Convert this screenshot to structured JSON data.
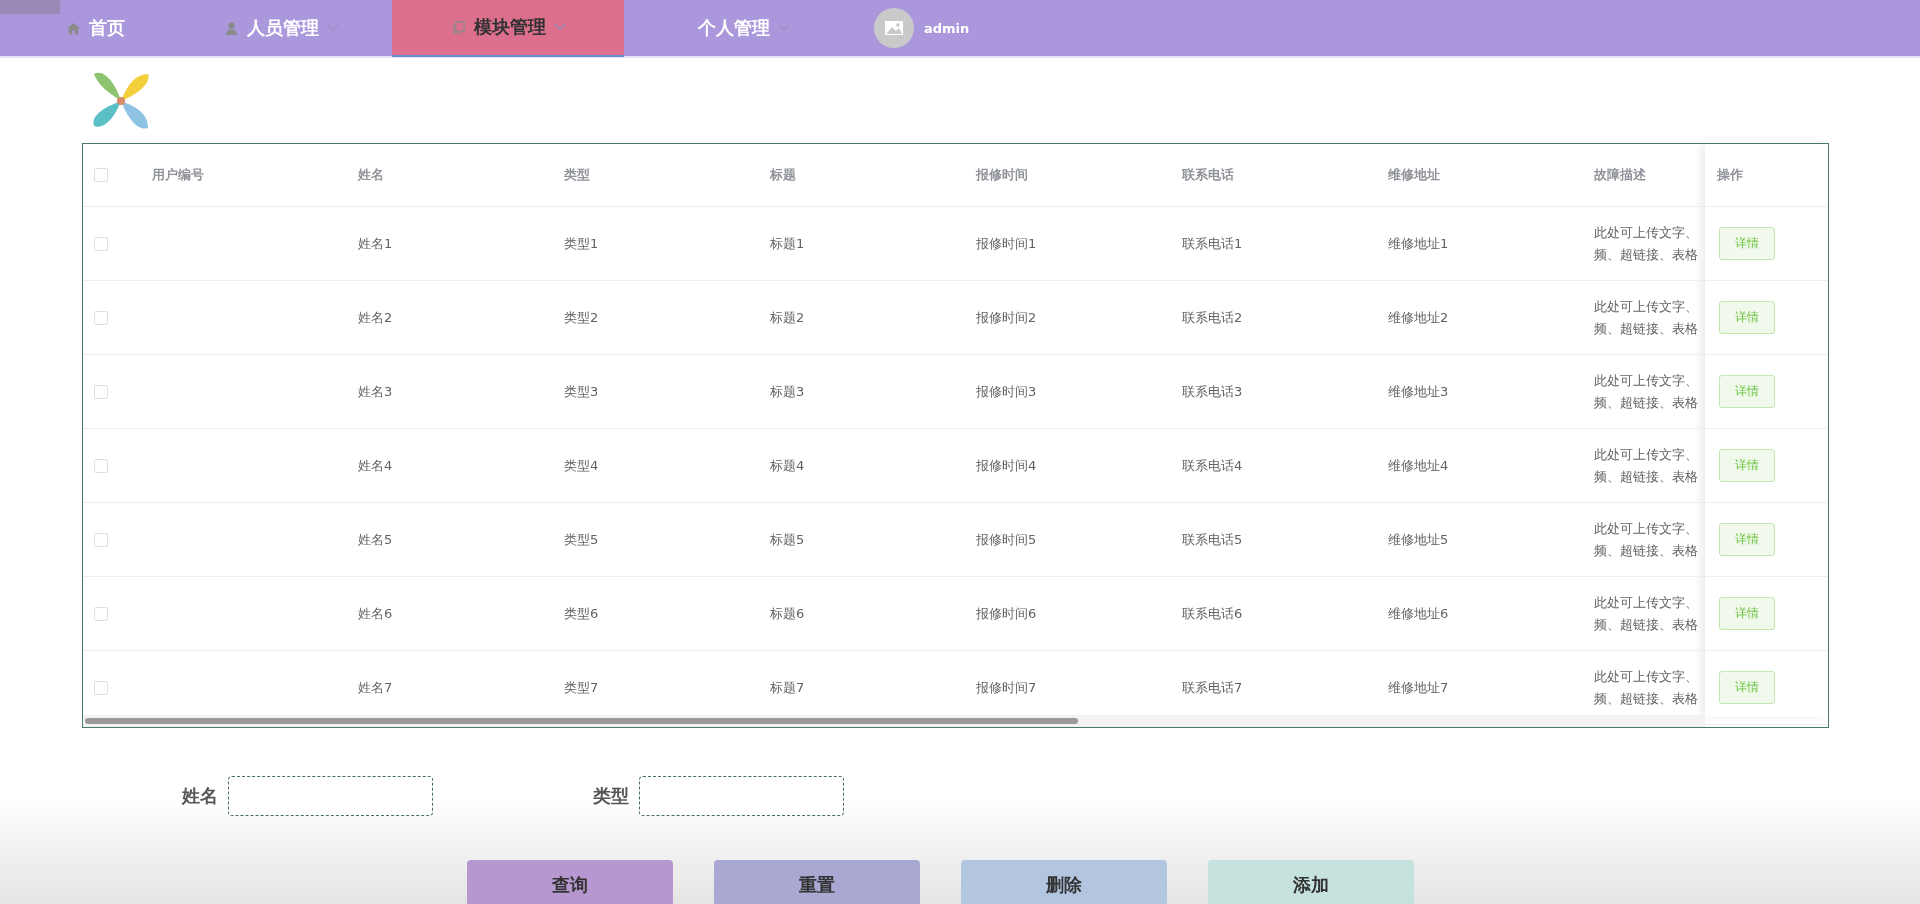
{
  "nav": {
    "tabs": [
      {
        "label": "首页",
        "selected": false,
        "has_dropdown": false
      },
      {
        "label": "人员管理",
        "selected": false,
        "has_dropdown": true
      },
      {
        "label": "模块管理",
        "selected": true,
        "has_dropdown": true
      },
      {
        "label": "个人管理",
        "selected": false,
        "has_dropdown": true
      }
    ],
    "user": "admin"
  },
  "table": {
    "header_checked": false,
    "columns": [
      "用户编号",
      "姓名",
      "类型",
      "标题",
      "报修时间",
      "联系电话",
      "维修地址",
      "故障描述"
    ],
    "action_column": "操作",
    "rows": [
      {
        "selected": false,
        "cells": [
          "",
          "姓名1",
          "类型1",
          "标题1",
          "报修时间1",
          "联系电话1",
          "维修地址1",
          "此处可上传文字、频、超链接、表格"
        ],
        "action": "详情"
      },
      {
        "selected": false,
        "cells": [
          "",
          "姓名2",
          "类型2",
          "标题2",
          "报修时间2",
          "联系电话2",
          "维修地址2",
          "此处可上传文字、频、超链接、表格"
        ],
        "action": "详情"
      },
      {
        "selected": false,
        "cells": [
          "",
          "姓名3",
          "类型3",
          "标题3",
          "报修时间3",
          "联系电话3",
          "维修地址3",
          "此处可上传文字、频、超链接、表格"
        ],
        "action": "详情"
      },
      {
        "selected": false,
        "cells": [
          "",
          "姓名4",
          "类型4",
          "标题4",
          "报修时间4",
          "联系电话4",
          "维修地址4",
          "此处可上传文字、频、超链接、表格"
        ],
        "action": "详情"
      },
      {
        "selected": false,
        "cells": [
          "",
          "姓名5",
          "类型5",
          "标题5",
          "报修时间5",
          "联系电话5",
          "维修地址5",
          "此处可上传文字、频、超链接、表格"
        ],
        "action": "详情"
      },
      {
        "selected": false,
        "cells": [
          "",
          "姓名6",
          "类型6",
          "标题6",
          "报修时间6",
          "联系电话6",
          "维修地址6",
          "此处可上传文字、频、超链接、表格"
        ],
        "action": "详情"
      },
      {
        "selected": false,
        "cells": [
          "",
          "姓名7",
          "类型7",
          "标题7",
          "报修时间7",
          "联系电话7",
          "维修地址7",
          "此处可上传文字、频、超链接、表格"
        ],
        "action": "详情"
      }
    ]
  },
  "filters": [
    {
      "label": "姓名"
    },
    {
      "label": "类型"
    }
  ],
  "buttons": [
    {
      "label": "查询",
      "color": "#b797cf"
    },
    {
      "label": "重置",
      "color": "#a9a8d3"
    },
    {
      "label": "删除",
      "color": "#b3c6e0"
    },
    {
      "label": "添加",
      "color": "#c6e2de"
    }
  ]
}
